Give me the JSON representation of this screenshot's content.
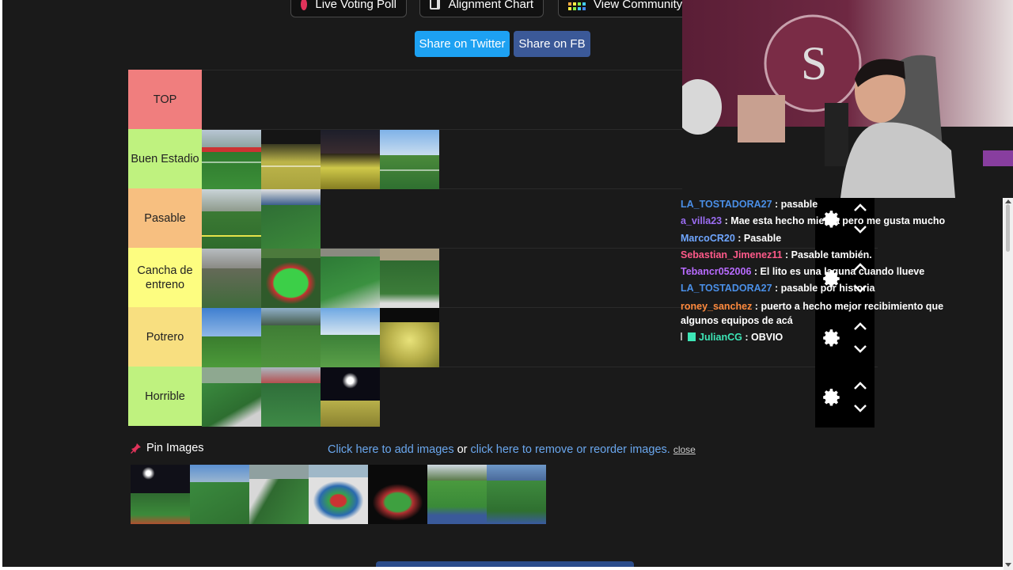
{
  "toolbar": {
    "live_voting_label": "Live Voting Poll",
    "alignment_chart_label": "Alignment Chart",
    "community_label": "View Community R"
  },
  "share": {
    "twitter_label": "Share on Twitter",
    "fb_label": "Share on FB",
    "twitter_color": "#1da1f2",
    "fb_color": "#3b5998"
  },
  "tiers": [
    {
      "label": "TOP",
      "color": "#f07e7e",
      "count": 0
    },
    {
      "label": "Buen Estadio",
      "color": "#bff27f",
      "count": 4
    },
    {
      "label": "Pasable",
      "color": "#f7bf80",
      "count": 2
    },
    {
      "label": "Cancha de entreno",
      "color": "#fdfd80",
      "count": 4
    },
    {
      "label": "Potrero",
      "color": "#f8df80",
      "count": 4
    },
    {
      "label": "Horrible",
      "color": "#bff27f",
      "count": 3
    }
  ],
  "chat": {
    "messages": [
      {
        "user": "LA_TOSTADORA27",
        "color": "#4a8fe7",
        "text": "pasable"
      },
      {
        "user": "a_villa23",
        "color": "#9b6df2",
        "text": "Mae esta hecho mierda pero me gusta mucho"
      },
      {
        "user": "MarcoCR20",
        "color": "#6fa6ff",
        "text": "Pasable"
      },
      {
        "user": "Sebastian_Jimenez11",
        "color": "#ff5a8a",
        "text": "Pasable también."
      },
      {
        "user": "Tebancr052006",
        "color": "#b86bff",
        "text": "El lito es una laguna cuando llueve"
      },
      {
        "user": "LA_TOSTADORA27",
        "color": "#4a8fe7",
        "text": "pasable por historia"
      },
      {
        "user": "roney_sanchez",
        "color": "#ff8a3d",
        "text": "puerto a hecho mejor recibimiento que algunos equipos de acá"
      },
      {
        "user": "JulianCG",
        "color": "#3de6b6",
        "text": "OBVIO"
      }
    ]
  },
  "pin": {
    "label": "Pin Images",
    "add_link": "Click here to add images",
    "or_text": "or",
    "remove_link": "click here to remove or reorder images.",
    "close_label": "close"
  }
}
